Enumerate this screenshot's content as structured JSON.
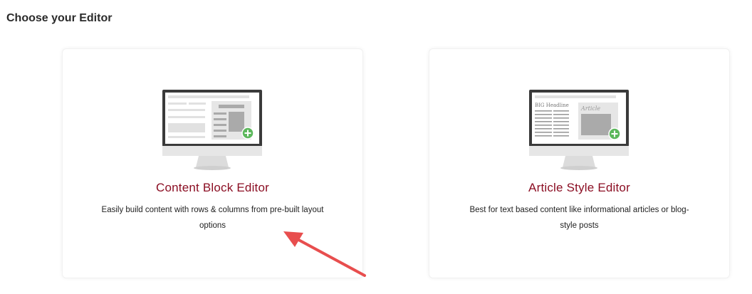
{
  "page": {
    "title": "Choose your Editor"
  },
  "cards": [
    {
      "title": "Content Block Editor",
      "description": "Easily build content with rows & columns from pre-built layout options",
      "icon": "monitor-block-layout-icon"
    },
    {
      "title": "Article Style Editor",
      "description": "Best for text based content like informational articles or blog-style posts",
      "icon": "monitor-article-layout-icon",
      "screen_headline": "BIG Headline",
      "screen_image_label": "Article"
    }
  ],
  "colors": {
    "accent": "#8b0e23",
    "plus_badge": "#5cb85c",
    "annotation_arrow": "#e84e4e"
  }
}
